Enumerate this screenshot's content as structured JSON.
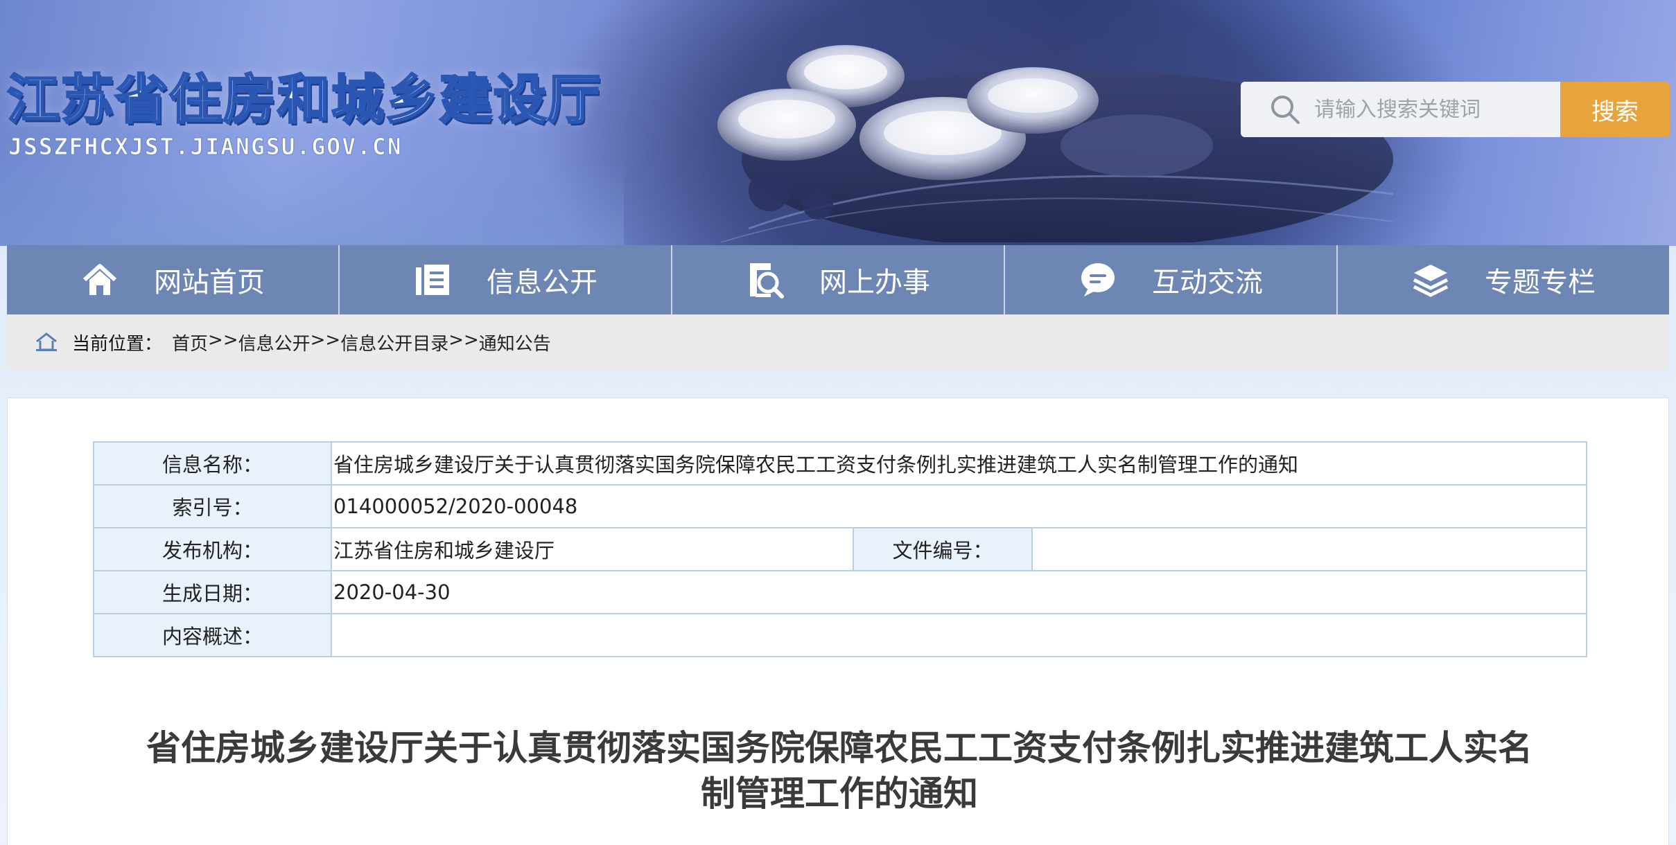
{
  "header": {
    "site_title": "江苏省住房和城乡建设厅",
    "site_domain": "JSSZFHCXJST.JIANGSU.GOV.CN",
    "search": {
      "placeholder": "请输入搜索关键词",
      "button_label": "搜索"
    }
  },
  "nav": {
    "items": [
      {
        "label": "网站首页",
        "icon": "home-icon"
      },
      {
        "label": "信息公开",
        "icon": "document-icon"
      },
      {
        "label": "网上办事",
        "icon": "search-doc-icon"
      },
      {
        "label": "互动交流",
        "icon": "chat-icon"
      },
      {
        "label": "专题专栏",
        "icon": "layers-icon"
      }
    ]
  },
  "breadcrumb": {
    "label": "当前位置：",
    "items": [
      "首页",
      "信息公开",
      "信息公开目录",
      "通知公告"
    ],
    "separator": ">>"
  },
  "meta": {
    "name_label": "信息名称：",
    "name_value": "省住房城乡建设厅关于认真贯彻落实国务院保障农民工工资支付条例扎实推进建筑工人实名制管理工作的通知",
    "index_label": "索引号：",
    "index_value": "014000052/2020-00048",
    "publisher_label": "发布机构：",
    "publisher_value": "江苏省住房和城乡建设厅",
    "doc_no_label": "文件编号：",
    "doc_no_value": "",
    "date_label": "生成日期：",
    "date_value": "2020-04-30",
    "summary_label": "内容概述：",
    "summary_value": ""
  },
  "article": {
    "title": "省住房城乡建设厅关于认真贯彻落实国务院保障农民工工资支付条例扎实推进建筑工人实名制管理工作的通知"
  },
  "colors": {
    "nav_bg": "#6d86b4",
    "search_button": "#e7a43c",
    "table_border": "#b9cfdf",
    "table_label_bg": "#e9f2fb"
  }
}
